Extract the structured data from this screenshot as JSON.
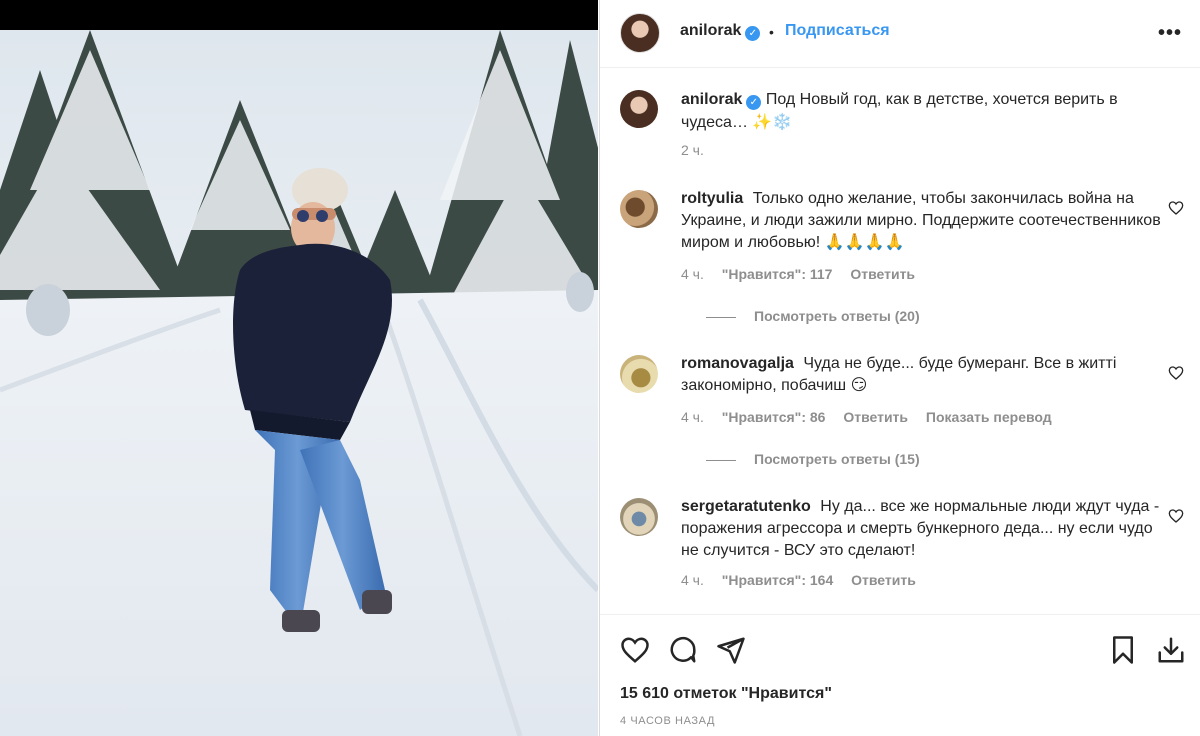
{
  "post": {
    "author": "anilorak",
    "follow_label": "Подписаться",
    "dot_separator": "•",
    "more_label": "•••",
    "verified_mark": "✓",
    "caption": "Под Новый год, как в детстве, хочется верить в чудеса… ✨❄️",
    "caption_time": "2 ч.",
    "likes": "15 610 отметок \"Нравится\"",
    "posted_ago": "4 ЧАСОВ НАЗАД"
  },
  "comments": [
    {
      "user": "roltyulia",
      "text": "Только одно желание, чтобы закончилась война на Украине, и люди зажили мирно. Поддержите соотечественников миром и любовью! 🙏🙏🙏🙏",
      "time": "4 ч.",
      "likes": "\"Нравится\": 117",
      "reply": "Ответить",
      "view_replies": "Посмотреть ответы (20)"
    },
    {
      "user": "romanovagalja",
      "text": "Чуда не буде... буде бумеранг. Все в житті закономірно, побачиш 😏",
      "time": "4 ч.",
      "likes": "\"Нравится\": 86",
      "reply": "Ответить",
      "translate": "Показать перевод",
      "view_replies": "Посмотреть ответы (15)"
    },
    {
      "user": "sergetaratutenko",
      "text": "Ну да... все же нормальные люди ждут чуда - поражения агрессора и смерть бункерного деда... ну если чудо не случится - ВСУ это сделают!",
      "time": "4 ч.",
      "likes": "\"Нравится\": 164",
      "reply": "Ответить"
    }
  ],
  "icons": {
    "like": "heart-icon",
    "comment": "comment-icon",
    "share": "share-icon",
    "save": "bookmark-icon",
    "download": "download-icon"
  },
  "colors": {
    "link_blue": "#3897f0",
    "text": "#262626",
    "muted": "#8e8e8e"
  }
}
